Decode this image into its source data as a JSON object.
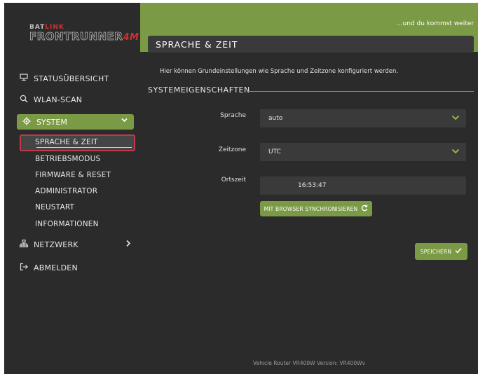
{
  "logo": {
    "line1_a": "BAT",
    "line1_b": "LINK",
    "line2_a": "FRONTRUNNER",
    "line2_b": "4M"
  },
  "sidebar": {
    "items": [
      {
        "label": "STATUSÜBERSICHT",
        "icon": "monitor-icon"
      },
      {
        "label": "WLAN-SCAN",
        "icon": "search-icon"
      },
      {
        "label": "SYSTEM",
        "icon": "gear-icon"
      },
      {
        "label": "NETZWERK",
        "icon": "network-icon"
      },
      {
        "label": "ABMELDEN",
        "icon": "logout-icon"
      }
    ],
    "system_sub": [
      {
        "label": "SPRACHE & ZEIT"
      },
      {
        "label": "BETRIEBSMODUS"
      },
      {
        "label": "FIRMWARE & RESET"
      },
      {
        "label": "ADMINISTRATOR"
      },
      {
        "label": "NEUSTART"
      },
      {
        "label": "INFORMATIONEN"
      }
    ]
  },
  "header": {
    "tagline": "...und du kommst weiter",
    "title": "SPRACHE & ZEIT"
  },
  "main": {
    "description": "Hier können Grundeinstellungen wie Sprache und Zeitzone konfiguriert werden.",
    "section_title": "SYSTEMEIGENSCHAFTEN",
    "fields": {
      "language_label": "Sprache",
      "language_value": "auto",
      "timezone_label": "Zeitzone",
      "timezone_value": "UTC",
      "localtime_label": "Ortszeit",
      "localtime_value": "16:53:47"
    },
    "sync_button": "MIT BROWSER SYNCHRONISIEREN",
    "save_button": "SPEICHERN"
  },
  "footer": {
    "text": "Vehicle Router VR400W Version: VR400Wv"
  },
  "colors": {
    "accent": "#7b9a45",
    "background": "#2b2b2b",
    "panel": "#3a3a3a",
    "active_border": "#c0394b"
  }
}
